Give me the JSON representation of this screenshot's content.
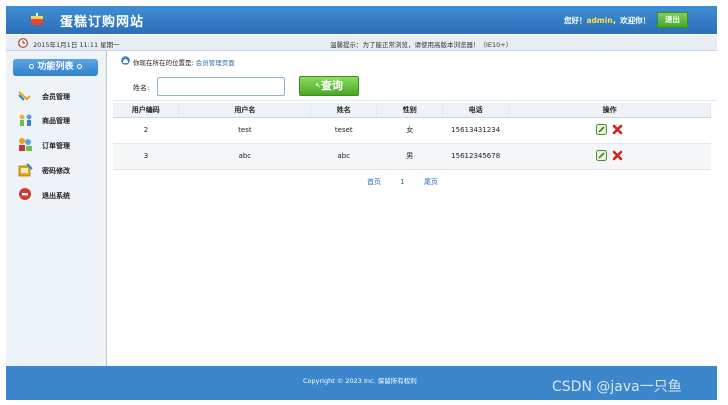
{
  "header": {
    "title": "蛋糕订购网站",
    "welcome_prefix": "您好！",
    "username": "admin",
    "welcome_suffix": "，欢迎你！",
    "logout_label": "退出"
  },
  "infobar": {
    "datetime": "2015年1月1日 11:11 星期一",
    "notice": "温馨提示：为了能正常浏览，请使用高版本浏览器！（IE10+）"
  },
  "sidebar": {
    "header": "功能列表",
    "items": [
      {
        "label": "会员管理",
        "icon": "members-icon"
      },
      {
        "label": "商品管理",
        "icon": "products-icon"
      },
      {
        "label": "订单管理",
        "icon": "orders-icon"
      },
      {
        "label": "密码修改",
        "icon": "password-icon"
      },
      {
        "label": "退出系统",
        "icon": "exit-icon"
      }
    ]
  },
  "breadcrumb": {
    "prefix": "你现在所在的位置是:",
    "page": "会员管理页面"
  },
  "search": {
    "label": "姓名:",
    "value": "",
    "button_label": "查询"
  },
  "table": {
    "columns": [
      "用户编码",
      "用户名",
      "姓名",
      "性别",
      "电话",
      "操作"
    ],
    "rows": [
      {
        "id": "2",
        "username": "test",
        "name": "teset",
        "gender": "女",
        "phone": "15613431234"
      },
      {
        "id": "3",
        "username": "abc",
        "name": "abc",
        "gender": "男",
        "phone": "15612345678"
      }
    ]
  },
  "pager": {
    "first": "首页",
    "current": "1",
    "last": "尾页"
  },
  "footer": {
    "copyright": "Copyright © 2023 Inc. 保留所有权利",
    "watermark": "CSDN @java一只鱼"
  },
  "colors": {
    "header_blue": "#2a6fb8",
    "button_green": "#4ba52a",
    "username_yellow": "#ffe14a"
  }
}
